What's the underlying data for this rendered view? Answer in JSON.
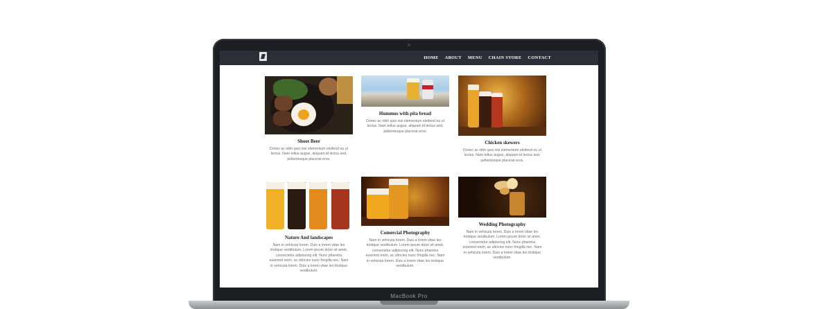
{
  "device": {
    "model_label": "MacBook Pro"
  },
  "nav": {
    "items": [
      "HOME",
      "ABOUT",
      "MENU",
      "CHAIN STORE",
      "CONTACT"
    ]
  },
  "cards": [
    {
      "title": "Shoot Beer",
      "text": "Donec ac nibh quis nisi elementum eleifend eu ut lectus. Nam tellus augue, aliquam id lectus sed, pellentesque placerat eros."
    },
    {
      "title": "Hummus with pita bread",
      "text": "Donec ac nibh quis nisi elementum eleifend eu ut lectus. Nam tellus augue, aliquam id lectus sed, pellentesque placerat eros."
    },
    {
      "title": "Chicken skewers",
      "text": "Donec ac nibh quis nisi elementum eleifend eu ut lectus. Nam tellus augue, aliquam id lectus sed, pellentesque placerat eros."
    },
    {
      "title": "Nature And landscapes",
      "text": "Nam in vehicula lorem. Duis a lorem vitae leo tristique vestibulum. Lorem ipsum dolor sit amet, consectetur adipiscing elit. Nunc pharetra euismod enim, ac ultricies nunc fringilla nec. Nam in vehicula lorem. Duis a lorem vitae leo tristique vestibulum."
    },
    {
      "title": "Comercial Photography",
      "text": "Nam in vehicula lorem. Duis a lorem vitae leo tristique vestibulum. Lorem ipsum dolor sit amet, consectetur adipiscing elit. Nunc pharetra euismod enim, ac ultricies nunc fringilla nec. Nam in vehicula lorem. Duis a lorem vitae leo tristique vestibulum."
    },
    {
      "title": "Wedding Photography",
      "text": "Nam in vehicula lorem. Duis a lorem vitae leo tristique vestibulum. Lorem ipsum dolor sit amet, consectetur adipiscing elit. Nunc pharetra euismod enim, ac ultricies nunc fringilla nec. Nam in vehicula lorem. Duis a lorem vitae leo tristique vestibulum."
    }
  ]
}
